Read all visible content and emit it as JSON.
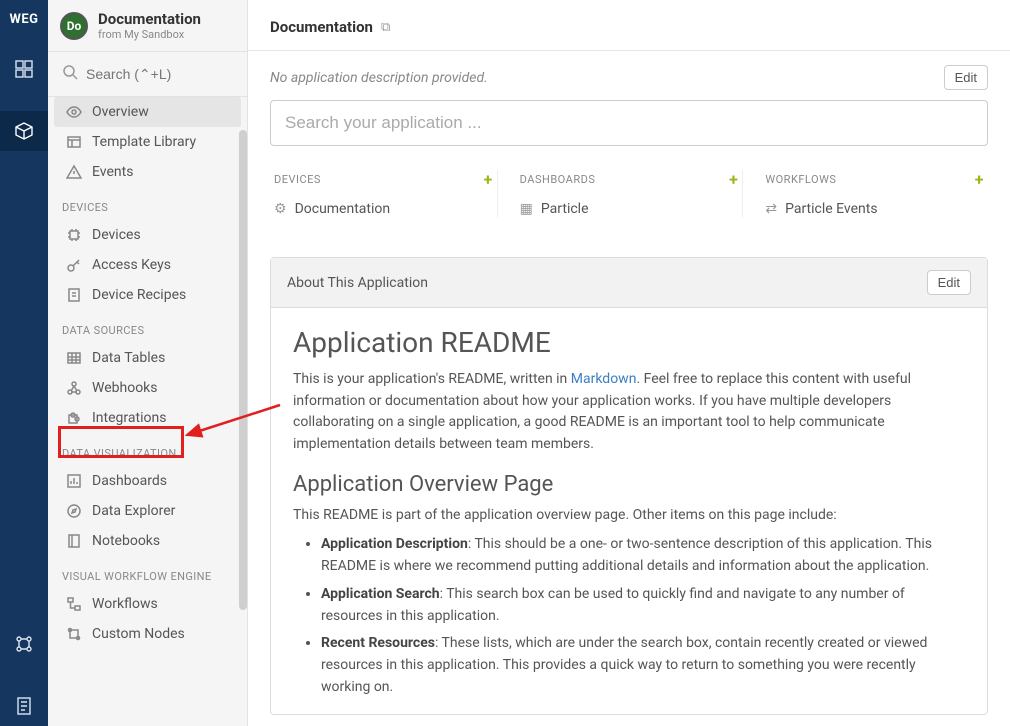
{
  "rail": {
    "logo": "WEG"
  },
  "nav": {
    "avatar": "Do",
    "title": "Documentation",
    "subtitle": "from My Sandbox",
    "search_placeholder": "Search (⌃+L)",
    "top": [
      {
        "label": "Overview",
        "active": true
      },
      {
        "label": "Template Library"
      },
      {
        "label": "Events"
      }
    ],
    "sections": [
      {
        "heading": "DEVICES",
        "items": [
          {
            "label": "Devices"
          },
          {
            "label": "Access Keys"
          },
          {
            "label": "Device Recipes"
          }
        ]
      },
      {
        "heading": "DATA SOURCES",
        "items": [
          {
            "label": "Data Tables"
          },
          {
            "label": "Webhooks"
          },
          {
            "label": "Integrations"
          }
        ]
      },
      {
        "heading": "DATA VISUALIZATION",
        "items": [
          {
            "label": "Dashboards"
          },
          {
            "label": "Data Explorer"
          },
          {
            "label": "Notebooks"
          }
        ]
      },
      {
        "heading": "VISUAL WORKFLOW ENGINE",
        "items": [
          {
            "label": "Workflows"
          },
          {
            "label": "Custom Nodes"
          }
        ]
      }
    ]
  },
  "main": {
    "title": "Documentation",
    "no_desc": "No application description provided.",
    "edit_label": "Edit",
    "search_placeholder": "Search your application ...",
    "cols": [
      {
        "heading": "DEVICES",
        "item": "Documentation"
      },
      {
        "heading": "DASHBOARDS",
        "item": "Particle"
      },
      {
        "heading": "WORKFLOWS",
        "item": "Particle Events"
      }
    ],
    "panel": {
      "heading": "About This Application",
      "h2": "Application README",
      "p1a": "This is your application's README, written in ",
      "p1_link": "Markdown",
      "p1b": ". Feel free to replace this content with useful information or documentation about how your application works. If you have multiple developers collaborating on a single application, a good README is an important tool to help communicate implementation details between team members.",
      "h3": "Application Overview Page",
      "p2": "This README is part of the application overview page. Other items on this page include:",
      "bullets": [
        {
          "b": "Application Description",
          "t": ": This should be a one- or two-sentence description of this application. This README is where we recommend putting additional details and information about the application."
        },
        {
          "b": "Application Search",
          "t": ": This search box can be used to quickly find and navigate to any number of resources in this application."
        },
        {
          "b": "Recent Resources",
          "t": ": These lists, which are under the search box, contain recently created or viewed resources in this application. This provides a quick way to return to something you were recently working on."
        }
      ]
    }
  }
}
